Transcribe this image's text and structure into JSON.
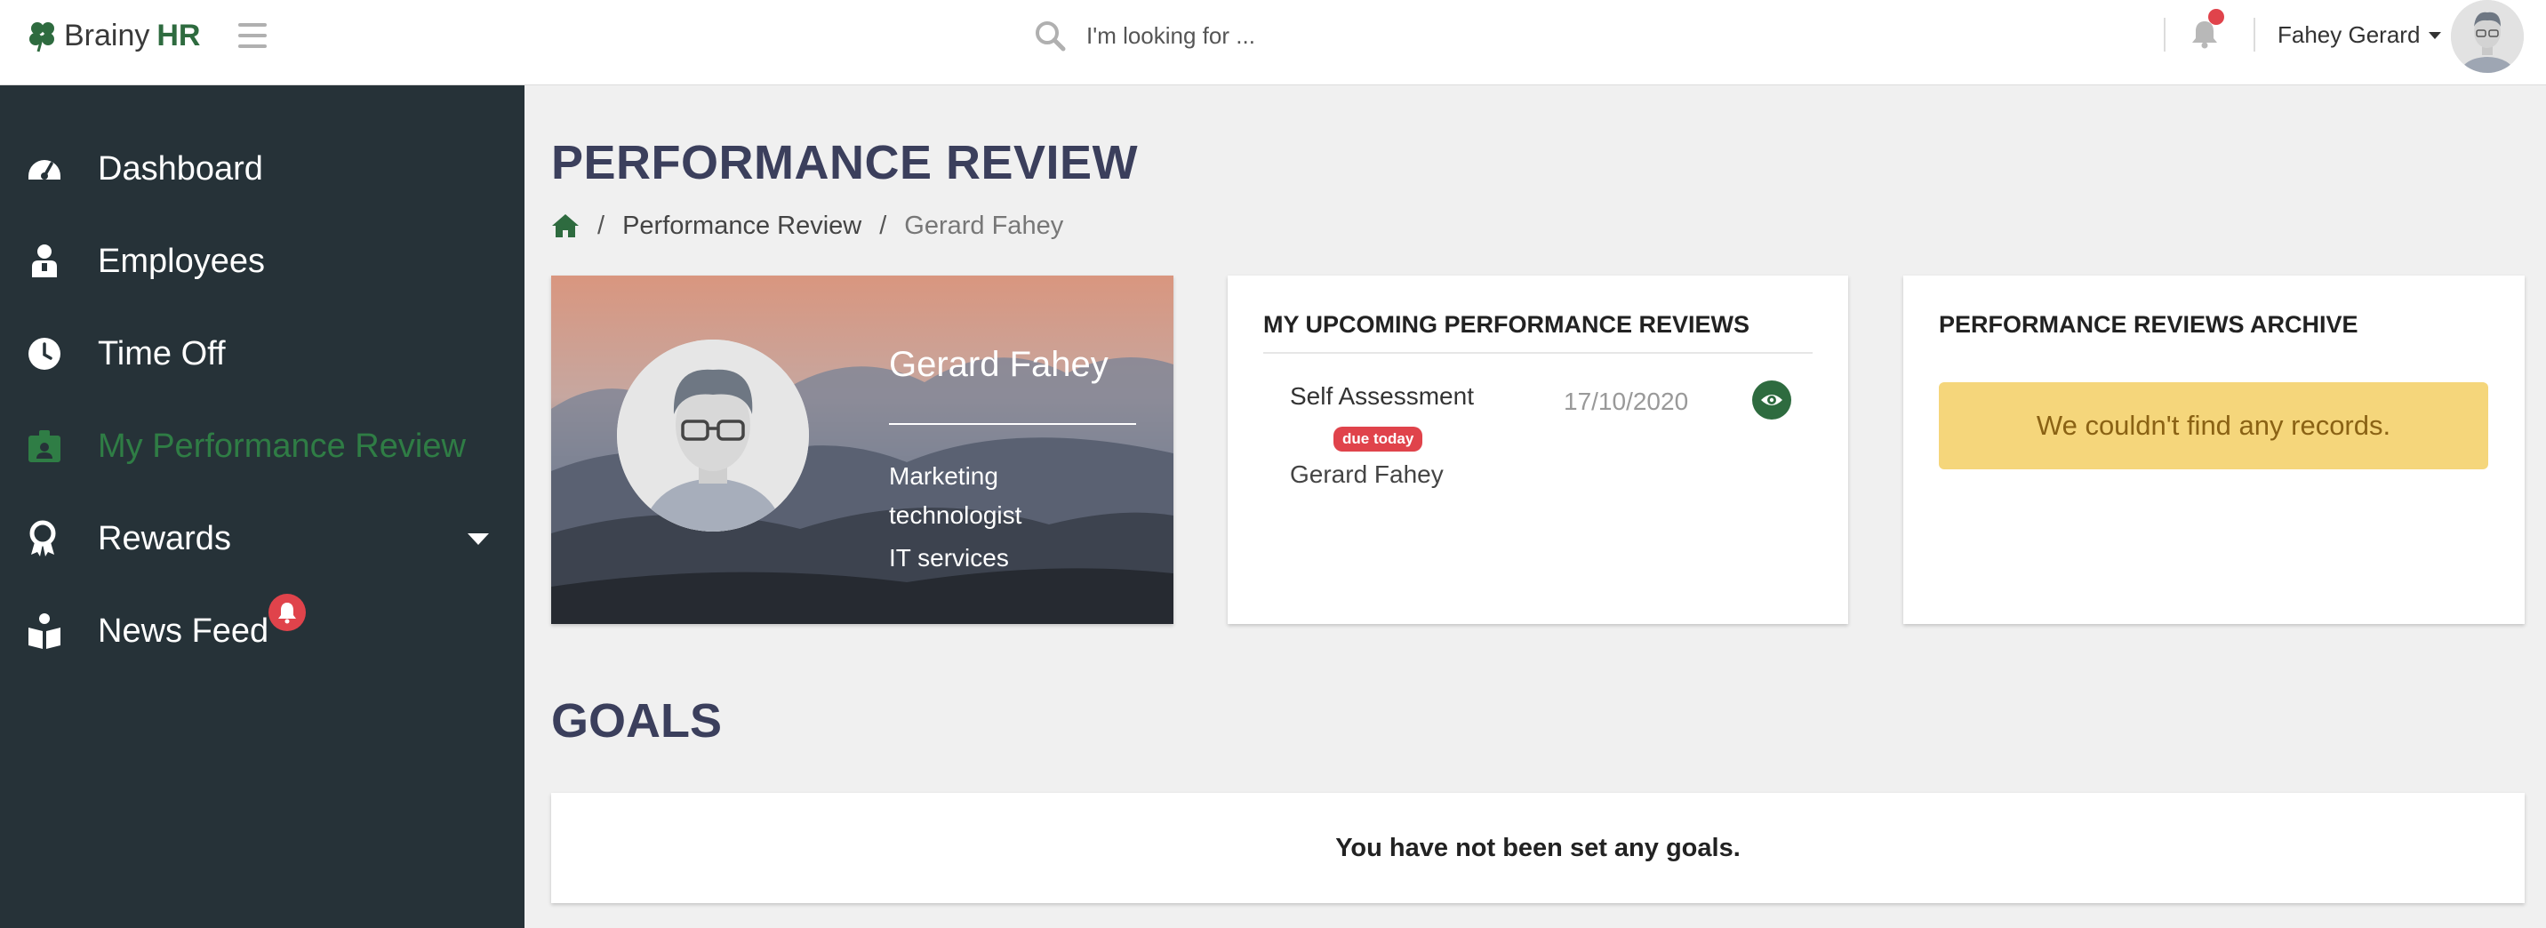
{
  "brand": {
    "name_part1": "Brainy",
    "name_part2": "HR",
    "accent": "#2e6b3f"
  },
  "header": {
    "search_placeholder": "I'm looking for ...",
    "user_name": "Fahey Gerard",
    "icons": [
      "menu-icon",
      "search-icon",
      "bell-icon",
      "user-avatar"
    ]
  },
  "sidebar": {
    "background": "#263238",
    "active_color": "#2f7d45",
    "items": [
      {
        "label": "Dashboard",
        "icon": "dashboard-gauge-icon"
      },
      {
        "label": "Employees",
        "icon": "employees-icon"
      },
      {
        "label": "Time Off",
        "icon": "clock-icon"
      },
      {
        "label": "My Performance Review",
        "icon": "id-badge-icon",
        "active": true
      },
      {
        "label": "Rewards",
        "icon": "award-icon",
        "has_submenu": true
      },
      {
        "label": "News Feed",
        "icon": "book-reader-icon",
        "notification": true
      }
    ]
  },
  "main": {
    "page_title": "PERFORMANCE REVIEW",
    "breadcrumb": {
      "separator": "/",
      "section": "Performance Review",
      "current": "Gerard Fahey"
    },
    "profile": {
      "name": "Gerard Fahey",
      "job_title": "Marketing technologist",
      "department": "IT services"
    },
    "upcoming": {
      "heading": "MY UPCOMING PERFORMANCE REVIEWS",
      "reviews": [
        {
          "type": "Self Assessment",
          "badge": "due today",
          "person": "Gerard Fahey",
          "date": "17/10/2020"
        }
      ]
    },
    "archive": {
      "heading": "PERFORMANCE REVIEWS ARCHIVE",
      "empty_message": "We couldn't find any records."
    },
    "goals": {
      "title": "GOALS",
      "empty_message": "You have not been set any goals."
    }
  }
}
